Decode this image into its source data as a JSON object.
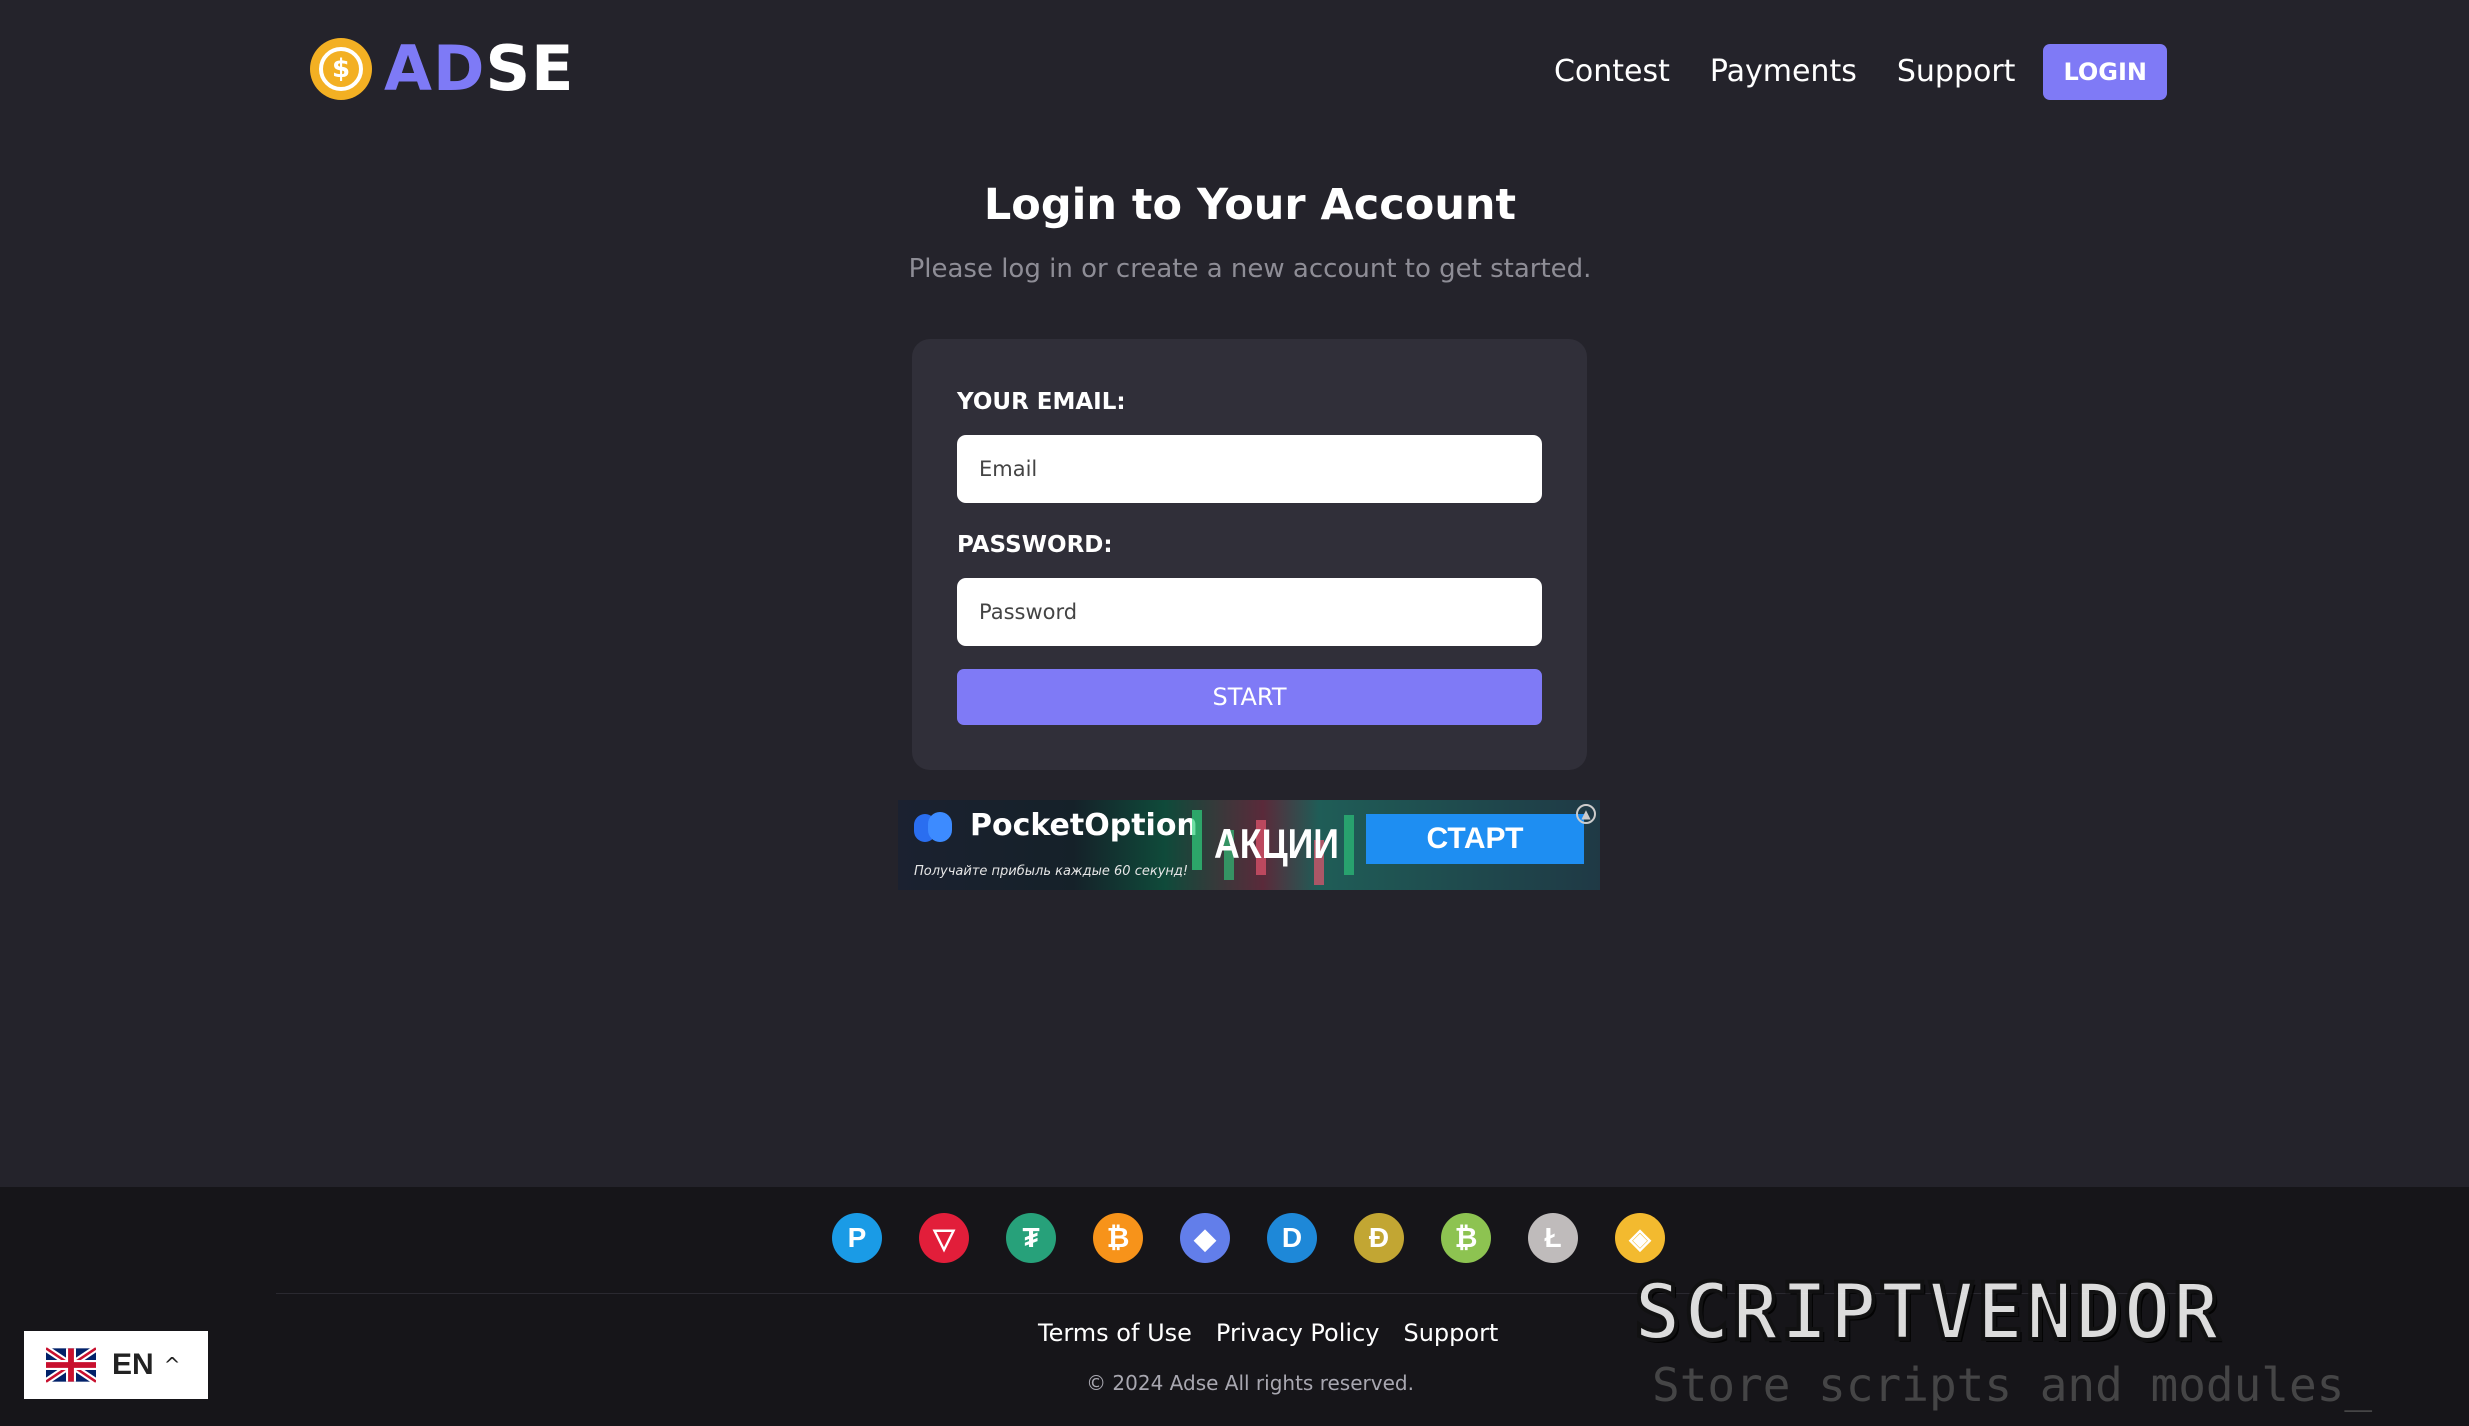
{
  "header": {
    "logo_prefix": "AD",
    "logo_suffix": "SE",
    "coin_symbol": "$",
    "nav": [
      "Contest",
      "Payments",
      "Support"
    ],
    "login_label": "LOGIN"
  },
  "main": {
    "title": "Login to Your Account",
    "subtitle": "Please log in or create a new account to get started.",
    "form": {
      "email_label": "YOUR EMAIL:",
      "email_placeholder": "Email",
      "password_label": "PASSWORD:",
      "password_placeholder": "Password",
      "submit_label": "START"
    }
  },
  "ad": {
    "brand": "PocketOption",
    "tagline": "Получайте прибыль каждые 60 секунд!",
    "promo": "АКЦИИ",
    "cta": "СТАРТ"
  },
  "footer": {
    "crypto_icons": [
      {
        "name": "paypal-icon",
        "glyph": "P",
        "color": "#1a9be6"
      },
      {
        "name": "tron-icon",
        "glyph": "▽",
        "color": "#e21e3a"
      },
      {
        "name": "tether-icon",
        "glyph": "₮",
        "color": "#27a17a"
      },
      {
        "name": "bitcoin-icon",
        "glyph": "₿",
        "color": "#f7931a"
      },
      {
        "name": "ethereum-icon",
        "glyph": "◆",
        "color": "#627eea"
      },
      {
        "name": "dash-icon",
        "glyph": "D",
        "color": "#1e88d8"
      },
      {
        "name": "dogecoin-icon",
        "glyph": "Ð",
        "color": "#c2a633"
      },
      {
        "name": "bitcoin-cash-icon",
        "glyph": "₿",
        "color": "#8dc351"
      },
      {
        "name": "litecoin-icon",
        "glyph": "Ł",
        "color": "#bfbbbb"
      },
      {
        "name": "binance-icon",
        "glyph": "◈",
        "color": "#f3ba2f"
      }
    ],
    "links": [
      "Terms of Use",
      "Privacy Policy",
      "Support"
    ],
    "copyright": "© 2024 Adse All rights reserved."
  },
  "language": {
    "code": "EN"
  },
  "watermark": {
    "title": "SCRIPTVENDOR",
    "subtitle": "Store scripts and modules_"
  },
  "colors": {
    "accent": "#7f7af6",
    "background": "#24232b",
    "card": "#302f39",
    "footer": "#161519"
  }
}
